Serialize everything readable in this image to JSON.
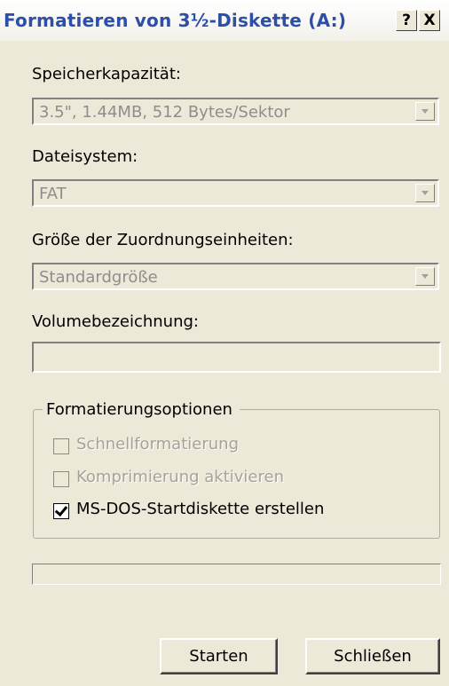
{
  "window": {
    "title": "Formatieren von 3½-Diskette (A:)",
    "help_button": "?",
    "close_button": "X"
  },
  "capacity": {
    "label": "Speicherkapazität:",
    "value": "3.5\",  1.44MB, 512 Bytes/Sektor"
  },
  "filesystem": {
    "label": "Dateisystem:",
    "value": "FAT"
  },
  "allocation": {
    "label": "Größe der Zuordnungseinheiten:",
    "value": "Standardgröße"
  },
  "volume": {
    "label": "Volumebezeichnung:",
    "value": ""
  },
  "options": {
    "title": "Formatierungsoptionen",
    "items": [
      {
        "label": "Schnellformatierung",
        "checked": false,
        "enabled": false
      },
      {
        "label": "Komprimierung aktivieren",
        "checked": false,
        "enabled": false
      },
      {
        "label": "MS-DOS-Startdiskette erstellen",
        "checked": true,
        "enabled": true
      }
    ]
  },
  "progress": {
    "value": 0
  },
  "buttons": {
    "start": "Starten",
    "close": "Schließen"
  },
  "colors": {
    "title_text": "#2e4fa8",
    "face": "#ece9d8",
    "disabled_text": "#8e8e8e"
  }
}
